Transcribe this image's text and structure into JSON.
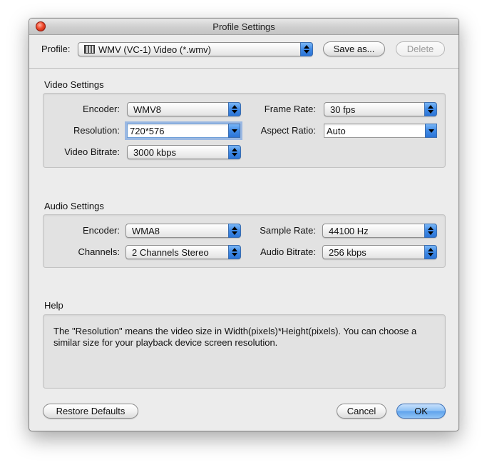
{
  "window": {
    "title": "Profile Settings"
  },
  "toolbar": {
    "profile_label": "Profile:",
    "profile_value": "WMV (VC-1) Video (*.wmv)",
    "save_as_label": "Save as...",
    "delete_label": "Delete"
  },
  "video": {
    "section_title": "Video Settings",
    "encoder_label": "Encoder:",
    "encoder_value": "WMV8",
    "frame_rate_label": "Frame Rate:",
    "frame_rate_value": "30 fps",
    "resolution_label": "Resolution:",
    "resolution_value": "720*576",
    "aspect_ratio_label": "Aspect Ratio:",
    "aspect_ratio_value": "Auto",
    "bitrate_label": "Video Bitrate:",
    "bitrate_value": "3000 kbps"
  },
  "audio": {
    "section_title": "Audio Settings",
    "encoder_label": "Encoder:",
    "encoder_value": "WMA8",
    "sample_rate_label": "Sample Rate:",
    "sample_rate_value": "44100 Hz",
    "channels_label": "Channels:",
    "channels_value": "2 Channels Stereo",
    "bitrate_label": "Audio Bitrate:",
    "bitrate_value": "256 kbps"
  },
  "help": {
    "section_title": "Help",
    "text": "The \"Resolution\" means the video size in Width(pixels)*Height(pixels).  You can choose a similar size for your playback device screen resolution."
  },
  "footer": {
    "restore_label": "Restore Defaults",
    "cancel_label": "Cancel",
    "ok_label": "OK"
  }
}
